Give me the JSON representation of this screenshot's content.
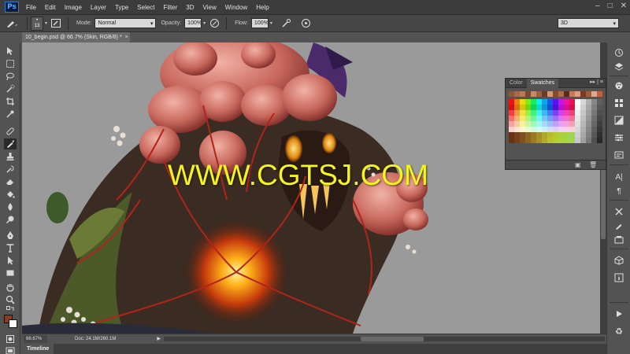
{
  "app": {
    "logo": "Ps"
  },
  "menu": [
    "File",
    "Edit",
    "Image",
    "Layer",
    "Type",
    "Select",
    "Filter",
    "3D",
    "View",
    "Window",
    "Help"
  ],
  "window_controls": [
    "–",
    "□",
    "✕"
  ],
  "options": {
    "brush_size": "13",
    "brush_top": "•",
    "mode_label": "Mode:",
    "mode_value": "Normal",
    "opacity_label": "Opacity:",
    "opacity_value": "100%",
    "flow_label": "Flow:",
    "flow_value": "100%",
    "workspace": "3D"
  },
  "document": {
    "tab_title": "10_begin.psd @ 66.7% (Skin, RGB/8) *",
    "close": "×"
  },
  "canvas": {
    "watermark": "WWW.CGTSJ.COM"
  },
  "swatches_panel": {
    "tab_color": "Color",
    "tab_swatches": "Swatches",
    "header_ctrl": "▸▸ | ≡"
  },
  "status": {
    "zoom": "66.67%",
    "doc": "Doc: 24.1M/260.1M",
    "arrow": "▶"
  },
  "timeline": {
    "label": "Timeline"
  },
  "colors": {
    "foreground": "#8b3c1c",
    "background": "#ffffff",
    "watermark": "#f5f51c"
  }
}
